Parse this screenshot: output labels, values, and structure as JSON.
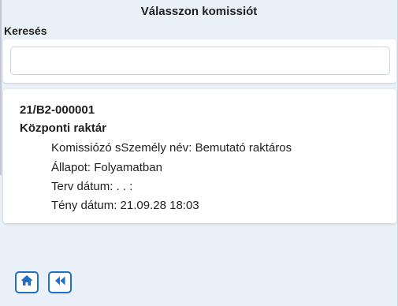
{
  "dialog": {
    "title": "Válasszon komissiót"
  },
  "search": {
    "label": "Keresés",
    "value": "",
    "placeholder": ""
  },
  "results": [
    {
      "code": "21/B2-000001",
      "warehouse": "Központi raktár",
      "details": [
        "Komissiózó sSzemély név: Bemutató raktáros",
        "Állapot: Folyamatban",
        "Terv dátum: . . :",
        "Tény dátum: 21.09.28 18:03"
      ]
    }
  ],
  "footer": {
    "home_icon": "home-icon",
    "back_icon": "double-chevron-left-icon"
  },
  "colors": {
    "accent": "#1f6fc5",
    "background": "#eaf0f7",
    "card": "#ffffff"
  }
}
